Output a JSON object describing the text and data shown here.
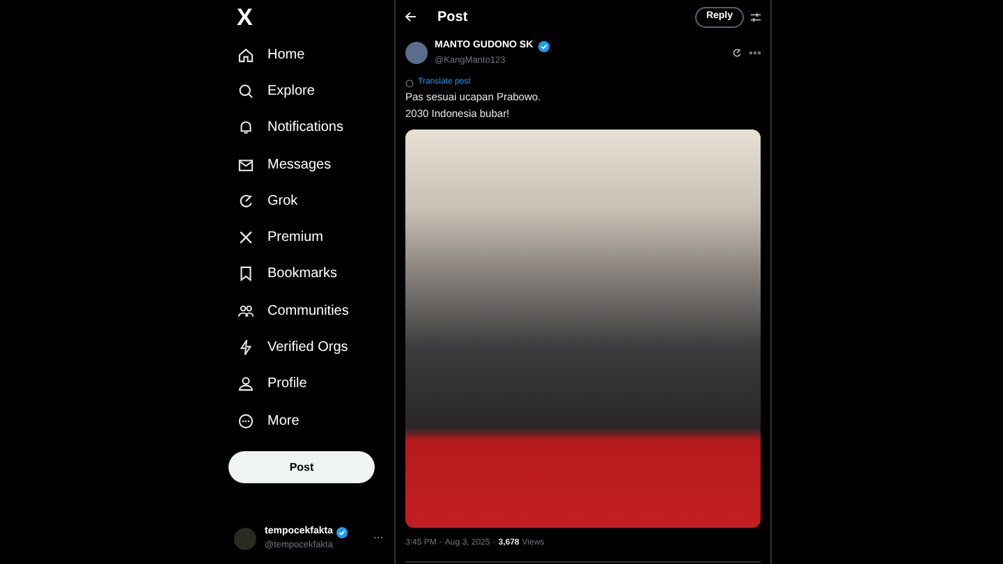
{
  "sidebar": {
    "logo": "X",
    "items": [
      {
        "label": "Home",
        "selected": false
      },
      {
        "label": "Explore",
        "selected": false
      },
      {
        "label": "Notifications",
        "selected": false
      },
      {
        "label": "Messages",
        "selected": false
      },
      {
        "label": "Grok",
        "selected": false
      },
      {
        "label": "Premium",
        "selected": false
      },
      {
        "label": "Bookmarks",
        "selected": false
      },
      {
        "label": "Communities",
        "selected": false
      },
      {
        "label": "Verified Orgs",
        "selected": false
      },
      {
        "label": "Profile",
        "selected": false
      },
      {
        "label": "More",
        "selected": false
      }
    ],
    "post_button": "Post",
    "account": {
      "name": "tempocekfakta",
      "handle": "@tempocekfakta",
      "verified": true,
      "menu": "···"
    }
  },
  "header": {
    "title": "Post",
    "reply_button": "Reply"
  },
  "post": {
    "author": "MANTO GUDONO SK",
    "handle": "@KangManto123",
    "verified": true,
    "translate": "Translate post",
    "text_lines": [
      "Pas sesuai ucapan Prabowo.",
      "2030 Indonesia bubar!"
    ],
    "time": "3:45 PM",
    "separator_1": "·",
    "date": "Aug 3, 2025",
    "separator_2": "·",
    "views_count": "3,678",
    "views_label": "Views"
  }
}
